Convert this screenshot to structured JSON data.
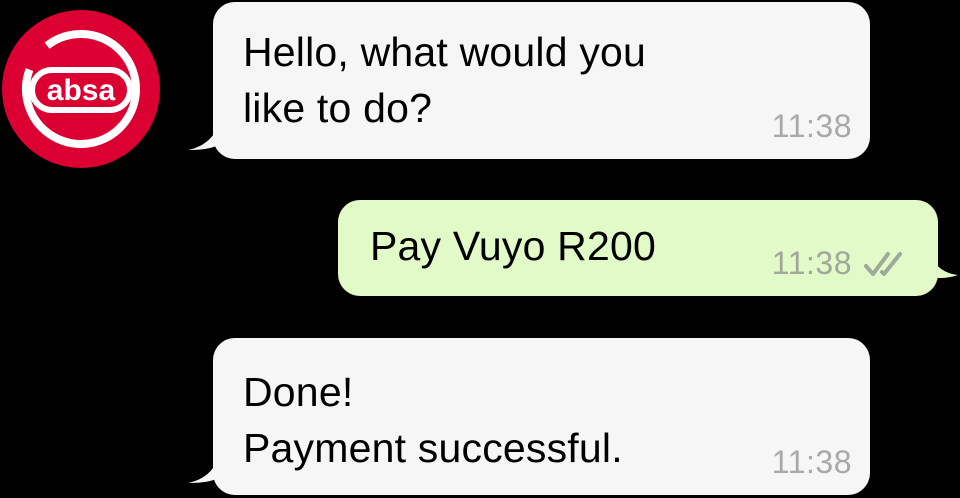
{
  "brand": {
    "name": "absa",
    "color": "#dc0032"
  },
  "messages": [
    {
      "direction": "incoming",
      "lines": [
        "Hello, what would you",
        "like to do?"
      ],
      "time": "11:38"
    },
    {
      "direction": "outgoing",
      "lines": [
        "Pay Vuyo R200"
      ],
      "time": "11:38",
      "status_icon": "double-check-icon"
    },
    {
      "direction": "incoming",
      "lines": [
        "Done!",
        "Payment successful."
      ],
      "time": "11:38"
    }
  ],
  "colors": {
    "background": "#000000",
    "incoming_bubble": "#f6f6f6",
    "outgoing_bubble": "#e2f9c8",
    "timestamp": "#a9a9a9"
  }
}
